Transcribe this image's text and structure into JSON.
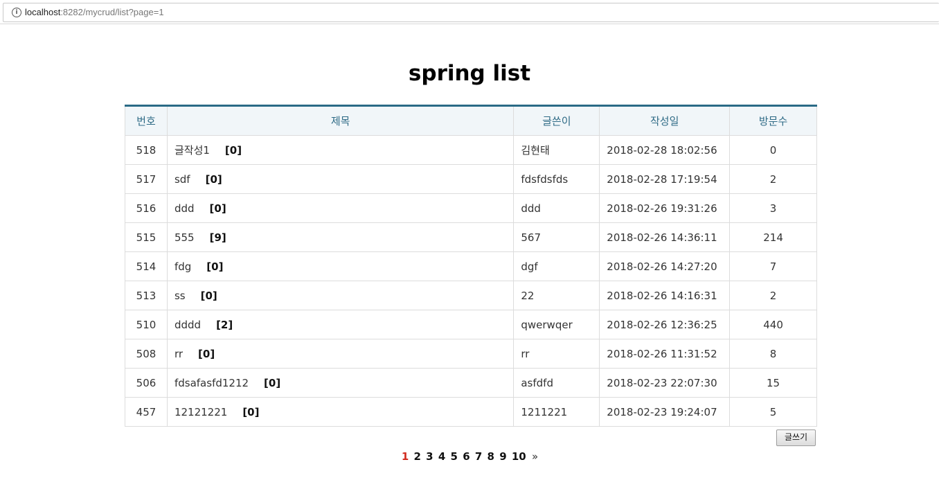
{
  "browser": {
    "url_host": "localhost",
    "url_rest": ":8282/mycrud/list?page=1"
  },
  "page": {
    "title": "spring  list",
    "write_button": "글쓰기"
  },
  "table": {
    "headers": [
      "번호",
      "제목",
      "글쓴이",
      "작성일",
      "방문수"
    ],
    "rows": [
      {
        "no": "518",
        "title": "글작성1",
        "comments": "[0]",
        "writer": "김현태",
        "date": "2018-02-28 18:02:56",
        "views": "0"
      },
      {
        "no": "517",
        "title": "sdf",
        "comments": "[0]",
        "writer": "fdsfdsfds",
        "date": "2018-02-28 17:19:54",
        "views": "2"
      },
      {
        "no": "516",
        "title": "ddd",
        "comments": "[0]",
        "writer": "ddd",
        "date": "2018-02-26 19:31:26",
        "views": "3"
      },
      {
        "no": "515",
        "title": "555",
        "comments": "[9]",
        "writer": "567",
        "date": "2018-02-26 14:36:11",
        "views": "214"
      },
      {
        "no": "514",
        "title": "fdg",
        "comments": "[0]",
        "writer": "dgf",
        "date": "2018-02-26 14:27:20",
        "views": "7"
      },
      {
        "no": "513",
        "title": "ss",
        "comments": "[0]",
        "writer": "22",
        "date": "2018-02-26 14:16:31",
        "views": "2"
      },
      {
        "no": "510",
        "title": "dddd",
        "comments": "[2]",
        "writer": "qwerwqer",
        "date": "2018-02-26 12:36:25",
        "views": "440"
      },
      {
        "no": "508",
        "title": "rr",
        "comments": "[0]",
        "writer": "rr",
        "date": "2018-02-26 11:31:52",
        "views": "8"
      },
      {
        "no": "506",
        "title": "fdsafasfd1212",
        "comments": "[0]",
        "writer": "asfdfd",
        "date": "2018-02-23 22:07:30",
        "views": "15"
      },
      {
        "no": "457",
        "title": "12121221",
        "comments": "[0]",
        "writer": "1211221",
        "date": "2018-02-23 19:24:07",
        "views": "5"
      }
    ]
  },
  "pagination": {
    "pages": [
      "1",
      "2",
      "3",
      "4",
      "5",
      "6",
      "7",
      "8",
      "9",
      "10"
    ],
    "current": "1",
    "next": "»"
  }
}
